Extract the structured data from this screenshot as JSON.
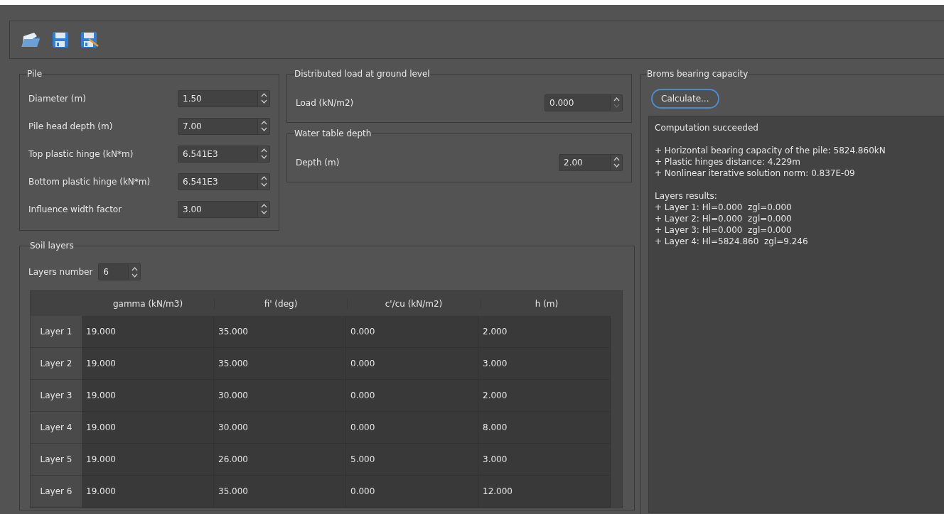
{
  "pile": {
    "title": "Pile",
    "fields": [
      {
        "label": "Diameter (m)",
        "value": "1.50",
        "down_enabled": true
      },
      {
        "label": "Pile head depth (m)",
        "value": "7.00",
        "down_enabled": true
      },
      {
        "label": "Top plastic hinge (kN*m)",
        "value": "6.541E3",
        "down_enabled": true
      },
      {
        "label": "Bottom plastic hinge (kN*m)",
        "value": "6.541E3",
        "down_enabled": true
      },
      {
        "label": "Influence width factor",
        "value": "3.00",
        "down_enabled": true
      }
    ]
  },
  "distributed_load": {
    "title": "Distributed load at ground level",
    "field": {
      "label": "Load (kN/m2)",
      "value": "0.000",
      "down_enabled": false
    }
  },
  "water_table": {
    "title": "Water table depth",
    "field": {
      "label": "Depth (m)",
      "value": "2.00",
      "down_enabled": true
    }
  },
  "soil_layers": {
    "title": "Soil layers",
    "layers_number": {
      "label": "Layers number",
      "value": "6"
    },
    "table": {
      "columns": [
        "gamma (kN/m3)",
        "fi' (deg)",
        "c'/cu (kN/m2)",
        "h (m)"
      ],
      "rows": [
        {
          "header": "Layer 1",
          "cells": [
            "19.000",
            "35.000",
            "0.000",
            "2.000"
          ]
        },
        {
          "header": "Layer 2",
          "cells": [
            "19.000",
            "35.000",
            "0.000",
            "3.000"
          ]
        },
        {
          "header": "Layer 3",
          "cells": [
            "19.000",
            "30.000",
            "0.000",
            "2.000"
          ]
        },
        {
          "header": "Layer 4",
          "cells": [
            "19.000",
            "30.000",
            "0.000",
            "8.000"
          ]
        },
        {
          "header": "Layer 5",
          "cells": [
            "19.000",
            "26.000",
            "5.000",
            "3.000"
          ]
        },
        {
          "header": "Layer 6",
          "cells": [
            "19.000",
            "35.000",
            "0.000",
            "12.000"
          ]
        }
      ]
    }
  },
  "broms": {
    "title": "Broms bearing capacity",
    "calculate_button": {
      "label": "Calculate...",
      "focused": true
    },
    "results": [
      [
        "Computation succeeded"
      ],
      [
        "+ Horizontal bearing capacity of the pile: 5824.860kN",
        "+ Plastic hinges distance: 4.229m",
        "+ Nonlinear iterative solution norm: 0.837E-09"
      ],
      [
        "Layers results:",
        "+ Layer 1: Hl=0.000  zgl=0.000",
        "+ Layer 2: Hl=0.000  zgl=0.000",
        "+ Layer 3: Hl=0.000  zgl=0.000",
        "+ Layer 4: Hl=5824.860  zgl=9.246"
      ]
    ]
  }
}
